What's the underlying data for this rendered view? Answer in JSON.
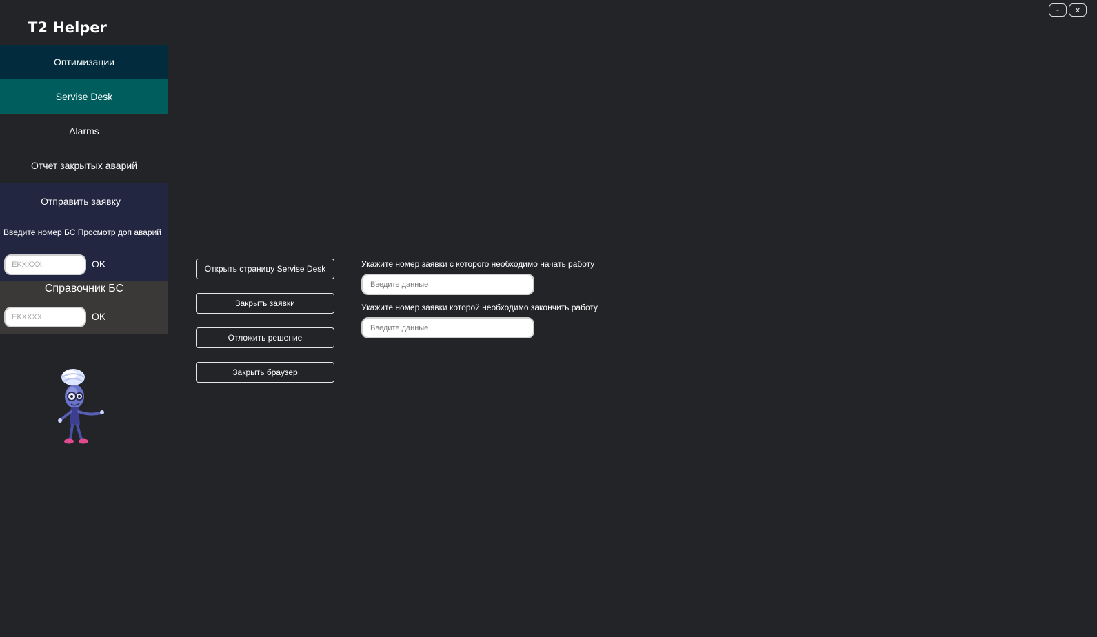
{
  "app": {
    "title": "T2 Helper"
  },
  "window_controls": {
    "minimize_label": "-",
    "close_label": "x"
  },
  "sidebar": {
    "items": [
      {
        "label": "Оптимизации",
        "active": false
      },
      {
        "label": "Servise Desk",
        "active": true
      },
      {
        "label": "Alarms",
        "active": false
      },
      {
        "label": "Отчет закрытых аварий",
        "active": false
      }
    ],
    "send_panel": {
      "title": "Отправить заявку",
      "hint": "Введите номер БС Просмотр доп аварий",
      "input_placeholder": "EKXXXX",
      "ok_label": "OK"
    },
    "reference_panel": {
      "title": "Справочник БС",
      "input_placeholder": "EKXXXX",
      "ok_label": "OK"
    },
    "mascot_icon": "mascot-character-icon"
  },
  "main": {
    "actions": [
      {
        "label": "Открыть страницу Servise Desk"
      },
      {
        "label": "Закрыть заявки"
      },
      {
        "label": "Отложить решение"
      },
      {
        "label": "Закрыть браузер"
      }
    ],
    "start_field": {
      "label": "Укажите номер заявки с которого необходимо начать работу",
      "placeholder": "Введите данные",
      "value": ""
    },
    "end_field": {
      "label": "Укажите номер заявки которой необходимо закончить работу",
      "placeholder": "Введите данные",
      "value": ""
    }
  },
  "colors": {
    "background": "#232427",
    "nav_optimizations": "#022c3d",
    "nav_active": "#005d5e",
    "send_panel": "#222640",
    "reference_panel": "#3b3838"
  }
}
